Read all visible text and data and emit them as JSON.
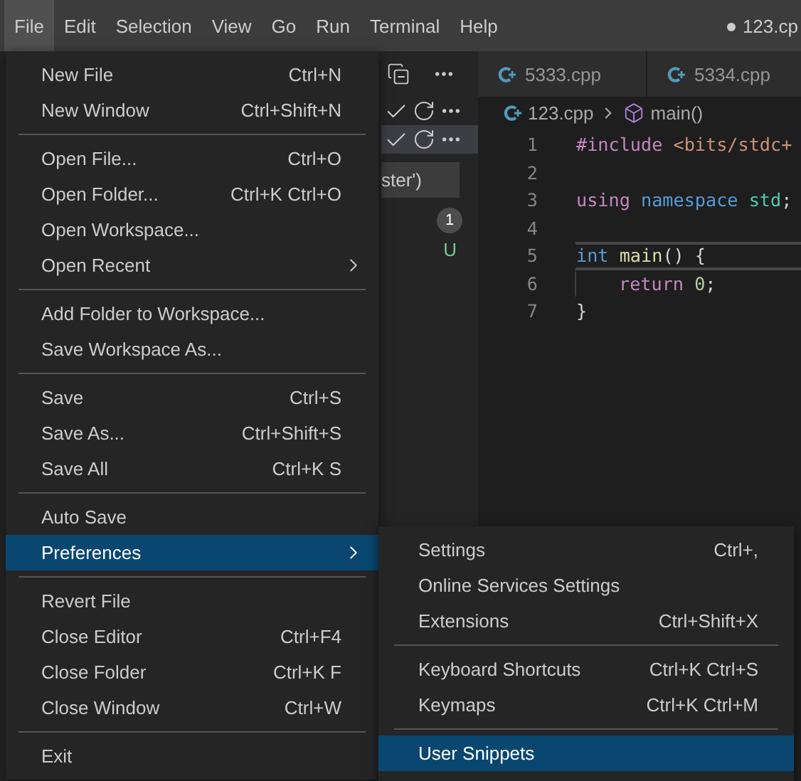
{
  "menubar": [
    {
      "label": "File",
      "selected": true
    },
    {
      "label": "Edit",
      "selected": false
    },
    {
      "label": "Selection",
      "selected": false
    },
    {
      "label": "View",
      "selected": false
    },
    {
      "label": "Go",
      "selected": false
    },
    {
      "label": "Run",
      "selected": false
    },
    {
      "label": "Terminal",
      "selected": false
    },
    {
      "label": "Help",
      "selected": false
    }
  ],
  "window_title": {
    "dirty": true,
    "text": "123.cp"
  },
  "sidebar": {
    "input_fragment": "ster')",
    "badge": "1",
    "status": "U",
    "rows": [
      {
        "selected": false
      },
      {
        "selected": true
      }
    ]
  },
  "editor": {
    "tabs": [
      {
        "label": "5333.cpp",
        "selected": false
      },
      {
        "label": "5334.cpp",
        "selected": false
      }
    ],
    "breadcrumb": [
      "123.cpp",
      "main()"
    ],
    "lines": [
      {
        "number": "1",
        "current": false,
        "indented": false,
        "tokens": [
          {
            "text": "#include ",
            "kind": "directive"
          },
          {
            "text": "<bits/stdc+",
            "kind": "string"
          }
        ]
      },
      {
        "number": "2",
        "current": false,
        "indented": false
      },
      {
        "number": "3",
        "current": false,
        "indented": false,
        "tokens": [
          {
            "text": "using ",
            "kind": "directive"
          },
          {
            "text": "namespace ",
            "kind": "keyword"
          },
          {
            "text": "std",
            "kind": "type"
          },
          {
            "text": ";",
            "kind": "plain"
          }
        ]
      },
      {
        "number": "4",
        "current": false,
        "indented": false
      },
      {
        "number": "5",
        "current": true,
        "indented": false,
        "tokens": [
          {
            "text": "int ",
            "kind": "keyword"
          },
          {
            "text": "main",
            "kind": "function"
          },
          {
            "text": "() {",
            "kind": "plain"
          }
        ]
      },
      {
        "number": "6",
        "current": false,
        "indented": true,
        "tokens": [
          {
            "text": "return ",
            "kind": "directive"
          },
          {
            "text": "0",
            "kind": "number"
          },
          {
            "text": ";",
            "kind": "plain"
          }
        ]
      },
      {
        "number": "7",
        "current": false,
        "indented": false,
        "tokens": [
          {
            "text": "}",
            "kind": "plain"
          }
        ]
      }
    ]
  },
  "file_menu": [
    {
      "kind": "item",
      "label": "New File",
      "shortcut": "Ctrl+N",
      "selected": false
    },
    {
      "kind": "item",
      "label": "New Window",
      "shortcut": "Ctrl+Shift+N",
      "selected": false
    },
    {
      "kind": "separator"
    },
    {
      "kind": "item",
      "label": "Open File...",
      "shortcut": "Ctrl+O",
      "selected": false
    },
    {
      "kind": "item",
      "label": "Open Folder...",
      "shortcut": "Ctrl+K Ctrl+O",
      "selected": false
    },
    {
      "kind": "item",
      "label": "Open Workspace...",
      "selected": false
    },
    {
      "kind": "submenu",
      "label": "Open Recent",
      "selected": false
    },
    {
      "kind": "separator"
    },
    {
      "kind": "item",
      "label": "Add Folder to Workspace...",
      "selected": false
    },
    {
      "kind": "item",
      "label": "Save Workspace As...",
      "selected": false
    },
    {
      "kind": "separator"
    },
    {
      "kind": "item",
      "label": "Save",
      "shortcut": "Ctrl+S",
      "selected": false
    },
    {
      "kind": "item",
      "label": "Save As...",
      "shortcut": "Ctrl+Shift+S",
      "selected": false
    },
    {
      "kind": "item",
      "label": "Save All",
      "shortcut": "Ctrl+K S",
      "selected": false
    },
    {
      "kind": "separator"
    },
    {
      "kind": "item",
      "label": "Auto Save",
      "selected": false
    },
    {
      "kind": "submenu",
      "label": "Preferences",
      "selected": true
    },
    {
      "kind": "separator"
    },
    {
      "kind": "item",
      "label": "Revert File",
      "selected": false
    },
    {
      "kind": "item",
      "label": "Close Editor",
      "shortcut": "Ctrl+F4",
      "selected": false
    },
    {
      "kind": "item",
      "label": "Close Folder",
      "shortcut": "Ctrl+K F",
      "selected": false
    },
    {
      "kind": "item",
      "label": "Close Window",
      "shortcut": "Ctrl+W",
      "selected": false
    },
    {
      "kind": "separator"
    },
    {
      "kind": "item",
      "label": "Exit",
      "selected": false
    }
  ],
  "preferences_menu": [
    {
      "kind": "item",
      "label": "Settings",
      "shortcut": "Ctrl+,",
      "selected": false
    },
    {
      "kind": "item",
      "label": "Online Services Settings",
      "selected": false
    },
    {
      "kind": "item",
      "label": "Extensions",
      "shortcut": "Ctrl+Shift+X",
      "selected": false
    },
    {
      "kind": "separator"
    },
    {
      "kind": "item",
      "label": "Keyboard Shortcuts",
      "shortcut": "Ctrl+K Ctrl+S",
      "selected": false
    },
    {
      "kind": "item",
      "label": "Keymaps",
      "shortcut": "Ctrl+K Ctrl+M",
      "selected": false
    },
    {
      "kind": "separator"
    },
    {
      "kind": "item",
      "label": "User Snippets",
      "selected": true
    }
  ]
}
